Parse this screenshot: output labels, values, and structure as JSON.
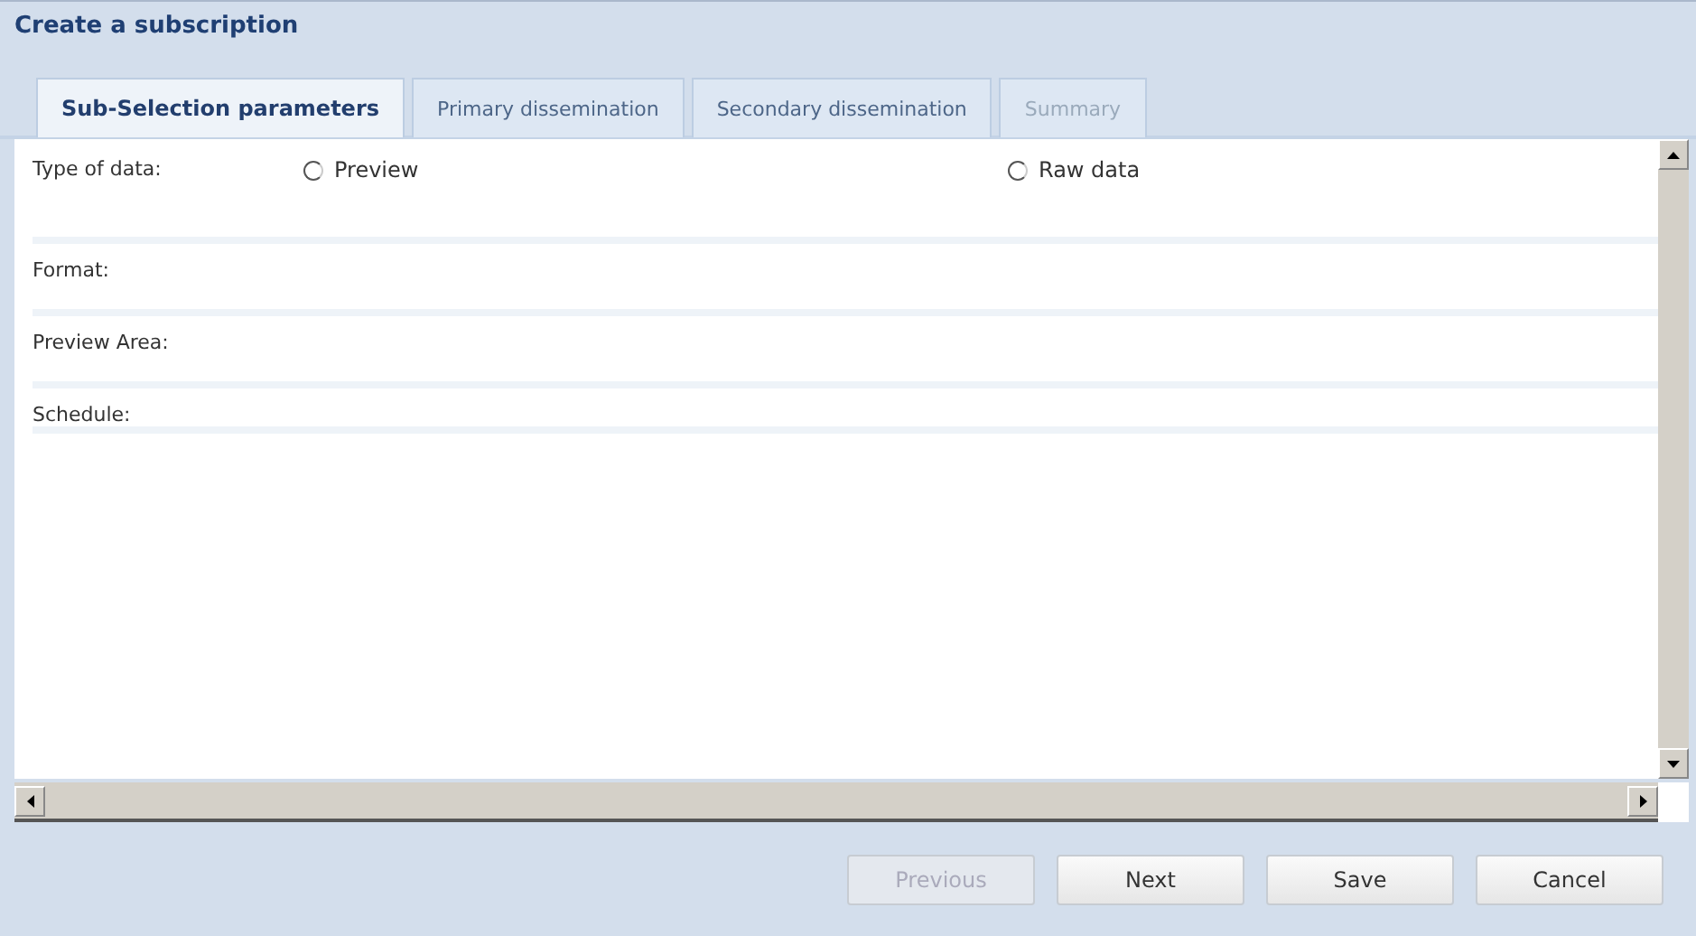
{
  "window": {
    "title": "Create a subscription"
  },
  "tabs": [
    {
      "label": "Sub-Selection parameters",
      "selected": true,
      "disabled": false
    },
    {
      "label": "Primary dissemination",
      "selected": false,
      "disabled": false
    },
    {
      "label": "Secondary dissemination",
      "selected": false,
      "disabled": false
    },
    {
      "label": "Summary",
      "selected": false,
      "disabled": true
    }
  ],
  "fields": [
    {
      "label": "Type of data:",
      "kind": "radio",
      "options": [
        {
          "label": "Preview",
          "selected": false
        },
        {
          "label": "Raw data",
          "selected": false
        }
      ]
    },
    {
      "label": "Format:",
      "kind": "empty"
    },
    {
      "label": "Preview Area:",
      "kind": "empty"
    },
    {
      "label": "Schedule:",
      "kind": "empty"
    }
  ],
  "buttons": [
    {
      "label": "Previous",
      "disabled": true
    },
    {
      "label": "Next",
      "disabled": false
    },
    {
      "label": "Save",
      "disabled": false
    },
    {
      "label": "Cancel",
      "disabled": false
    }
  ]
}
